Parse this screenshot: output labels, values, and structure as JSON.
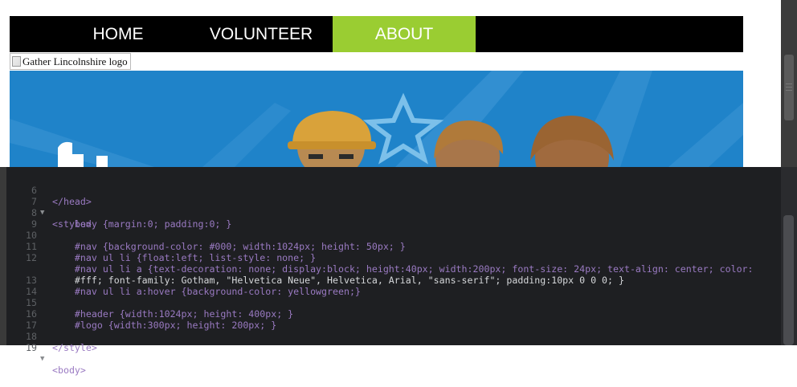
{
  "nav": {
    "items": [
      {
        "label": "HOME"
      },
      {
        "label": "VOLUNTEER"
      },
      {
        "label": "ABOUT"
      }
    ],
    "active_color": "#9acd32"
  },
  "logo": {
    "alt": "Gather Lincolnshire logo"
  },
  "colors": {
    "header_blue": "#1f83c9",
    "editor_bg": "#1e1f22"
  },
  "editor": {
    "lines": [
      {
        "n": "6",
        "fold": "",
        "code": "</head>"
      },
      {
        "n": "7",
        "fold": "▼",
        "code": "<style>"
      },
      {
        "n": "8",
        "fold": "",
        "code": "    body {margin:0; padding:0; }"
      },
      {
        "n": "9",
        "fold": "",
        "code": ""
      },
      {
        "n": "10",
        "fold": "",
        "code": "    #nav {background-color: #000; width:1024px; height: 50px; }"
      },
      {
        "n": "11",
        "fold": "",
        "code": "    #nav ul li {float:left; list-style: none; }"
      },
      {
        "n": "12",
        "fold": "",
        "code": "    #nav ul li a {text-decoration: none; display:block; height:40px; width:200px; font-size: 24px; text-align: center; color:"
      },
      {
        "n": "",
        "fold": "",
        "code": "    #fff; font-family: Gotham, \"Helvetica Neue\", Helvetica, Arial, \"sans-serif\"; padding:10px 0 0 0; }"
      },
      {
        "n": "13",
        "fold": "",
        "code": "    #nav ul li a:hover {background-color: yellowgreen;}"
      },
      {
        "n": "14",
        "fold": "",
        "code": ""
      },
      {
        "n": "15",
        "fold": "",
        "code": "    #header {width:1024px; height: 400px; }"
      },
      {
        "n": "16",
        "fold": "",
        "code": "    #logo {width:300px; height: 200px; }"
      },
      {
        "n": "17",
        "fold": "",
        "code": ""
      },
      {
        "n": "18",
        "fold": "",
        "code": "</style>"
      },
      {
        "n": "19",
        "fold": "▼",
        "code": "<body>"
      }
    ]
  }
}
